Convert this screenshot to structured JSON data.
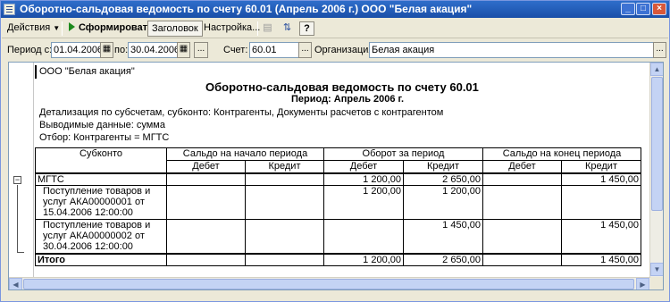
{
  "window": {
    "title": "Оборотно-сальдовая ведомость по счету 60.01 (Апрель 2006 г.) ООО \"Белая акация\"",
    "buttons": {
      "minimize": "_",
      "maximize": "□",
      "close": "×"
    }
  },
  "toolbar": {
    "actions_label": "Действия",
    "generate_label": "Сформировать",
    "header_label": "Заголовок",
    "settings_label": "Настройка...",
    "help_label": "?"
  },
  "params": {
    "period_from_label": "Период с:",
    "period_from_value": "01.04.2006",
    "period_to_label": "по:",
    "period_to_value": "30.04.2006",
    "period_btn": "...",
    "account_label": "Счет:",
    "account_value": "60.01",
    "account_btn": "...",
    "org_label": "Организация:",
    "org_value": "Белая акация",
    "org_btn": "..."
  },
  "report": {
    "org": "ООО \"Белая акация\"",
    "title": "Оборотно-сальдовая ведомость по счету 60.01",
    "period": "Период: Апрель 2006 г.",
    "detail": "Детализация по субсчетам, субконто: Контрагенты, Документы расчетов с контрагентом",
    "output": "Выводимые данные: сумма",
    "filter": "Отбор: Контрагенты = МГТС",
    "headers": {
      "subconto": "Субконто",
      "opening": "Сальдо на начало периода",
      "turnover": "Оборот за период",
      "closing": "Сальдо на конец периода",
      "debit": "Дебет",
      "credit": "Кредит"
    },
    "rows": [
      {
        "name": "МГТС",
        "d_open": "",
        "c_open": "",
        "d_turn": "1 200,00",
        "c_turn": "2 650,00",
        "d_close": "",
        "c_close": "1 450,00"
      },
      {
        "name": "Поступление товаров и услуг АКА00000001 от 15.04.2006 12:00:00",
        "d_open": "",
        "c_open": "",
        "d_turn": "1 200,00",
        "c_turn": "1 200,00",
        "d_close": "",
        "c_close": ""
      },
      {
        "name": "Поступление товаров и услуг АКА00000002 от 30.04.2006 12:00:00",
        "d_open": "",
        "c_open": "",
        "d_turn": "",
        "c_turn": "1 450,00",
        "d_close": "",
        "c_close": "1 450,00"
      }
    ],
    "total": {
      "name": "Итого",
      "d_open": "",
      "c_open": "",
      "d_turn": "1 200,00",
      "c_turn": "2 650,00",
      "d_close": "",
      "c_close": "1 450,00"
    },
    "group_toggle": "−"
  }
}
